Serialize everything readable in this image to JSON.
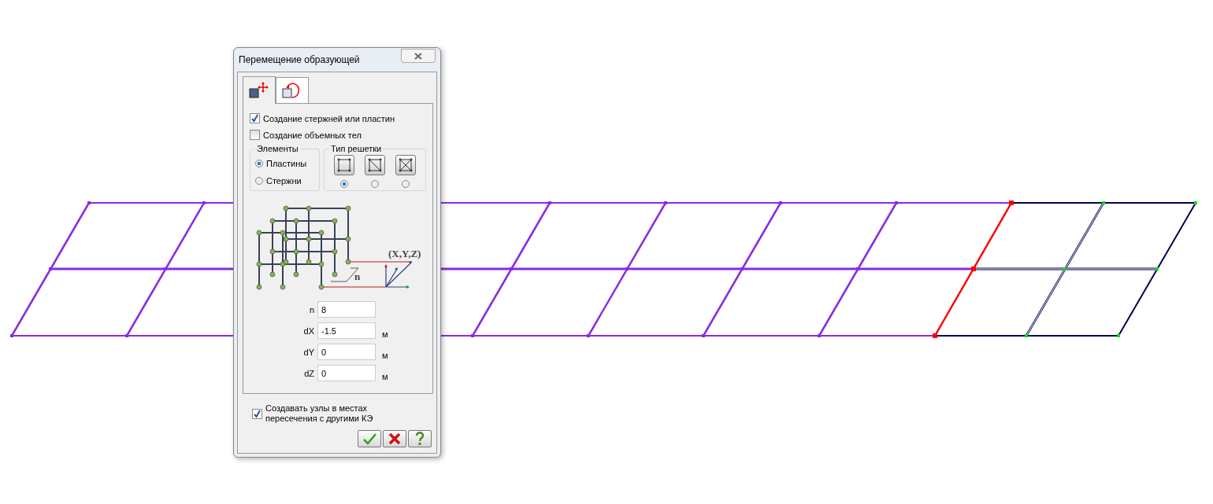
{
  "dialog": {
    "title": "Перемещение образующей",
    "tabs": [
      {
        "selected": true
      },
      {
        "selected": false
      }
    ],
    "options": [
      {
        "label": "Создание стержней или пластин",
        "checked": true
      },
      {
        "label": "Создание объемных тел",
        "checked": false
      }
    ],
    "elements": {
      "title": "Элементы",
      "items": [
        {
          "label": "Пластины",
          "selected": true
        },
        {
          "label": "Стержни",
          "selected": false
        }
      ]
    },
    "grid_type": {
      "title": "Тип решетки",
      "items": [
        {
          "kind": "square",
          "selected": true
        },
        {
          "kind": "diagonal",
          "selected": false
        },
        {
          "kind": "cross",
          "selected": false
        }
      ]
    },
    "diagram": {
      "coords_label": "(X,Y,Z)",
      "n_label": "n"
    },
    "fields": [
      {
        "label": "n",
        "value": "8"
      },
      {
        "label": "dX",
        "value": "-1.5",
        "unit": "м"
      },
      {
        "label": "dY",
        "value": "0",
        "unit": "м"
      },
      {
        "label": "dZ",
        "value": "0",
        "unit": "м"
      }
    ],
    "intersect": {
      "label": "Создавать узлы в местах пересечения с другими КЭ",
      "checked": true
    }
  }
}
